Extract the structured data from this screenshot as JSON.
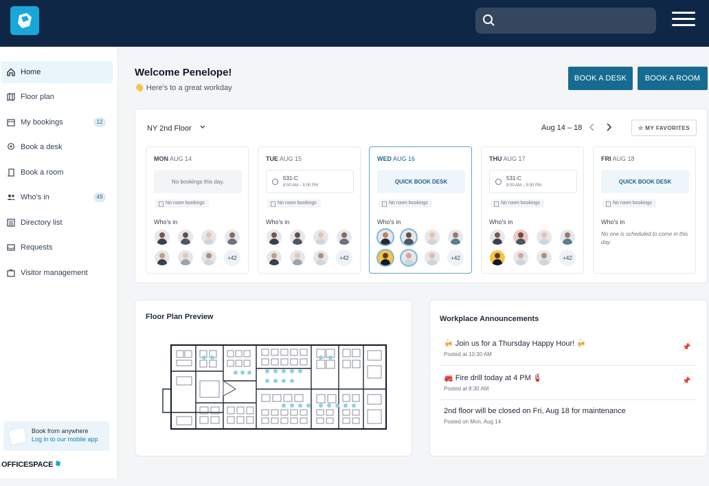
{
  "colors": {
    "topbar": "#0f2746",
    "accent": "#176b91",
    "selected_border": "#5fa4c7"
  },
  "sidebar": {
    "items": [
      {
        "label": "Home",
        "icon": "home-icon"
      },
      {
        "label": "Floor plan",
        "icon": "map-icon"
      },
      {
        "label": "My bookings",
        "icon": "calendar-icon",
        "badge": "12"
      },
      {
        "label": "Book a desk",
        "icon": "location-pin-icon"
      },
      {
        "label": "Book a room",
        "icon": "door-icon"
      },
      {
        "label": "Who's in",
        "icon": "people-icon",
        "badge": "49"
      },
      {
        "label": "Directory list",
        "icon": "list-icon"
      },
      {
        "label": "Requests",
        "icon": "inbox-icon"
      },
      {
        "label": "Visitor management",
        "icon": "briefcase-icon"
      }
    ],
    "promo_title": "Book from anywhere",
    "promo_text": "Log in to our mobile app",
    "brand": "OFFICESPACE"
  },
  "header": {
    "welcome": "Welcome Penelope!",
    "subtitle": "👋 Here's to a great workday",
    "book_desk": "BOOK A DESK",
    "book_room": "BOOK A ROOM"
  },
  "schedule": {
    "floor": "NY 2nd Floor",
    "date_range": "Aug 14 – 18",
    "favorites": "☆ MY FAVORITES",
    "days": [
      {
        "day": "MON",
        "date": "AUG 14",
        "booking": "No bookings this day.",
        "room": "No room bookings",
        "who": "Who's in",
        "more": "+42"
      },
      {
        "day": "TUE",
        "date": "AUG 15",
        "booking_title": "531-C",
        "booking_time": "8:00 AM – 5:00 PM",
        "room": "No room bookings",
        "who": "Who's in",
        "more": "+42"
      },
      {
        "day": "WED",
        "date": "AUG 16",
        "booking": "QUICK BOOK DESK",
        "room": "No room bookings",
        "who": "Who's in",
        "more": "+42"
      },
      {
        "day": "THU",
        "date": "AUG 17",
        "booking_title": "531-C",
        "booking_time": "8:00 AM – 5:00 PM",
        "room": "No room bookings",
        "who": "Who's in",
        "more": "+42"
      },
      {
        "day": "FRI",
        "date": "AUG 18",
        "booking": "QUICK BOOK DESK",
        "room": "No room bookings",
        "who": "Who's in",
        "empty": "No one is scheduled to come in this day."
      }
    ]
  },
  "floor_plan": {
    "title": "Floor Plan Preview"
  },
  "announcements": {
    "title": "Workplace Announcements",
    "items": [
      {
        "text": "🍻 Join us for a Thursday Happy Hour! 🍻",
        "posted": "Posted at 10:30 AM",
        "pinned": true
      },
      {
        "text": "🚒 Fire drill today at 4 PM 🧯",
        "posted": "Posted at 8:30 AM",
        "pinned": true
      },
      {
        "text": "2nd floor will be closed on Fri, Aug 18 for maintenance",
        "posted": "Posted on Mon, Aug 14",
        "pinned": false
      }
    ]
  }
}
